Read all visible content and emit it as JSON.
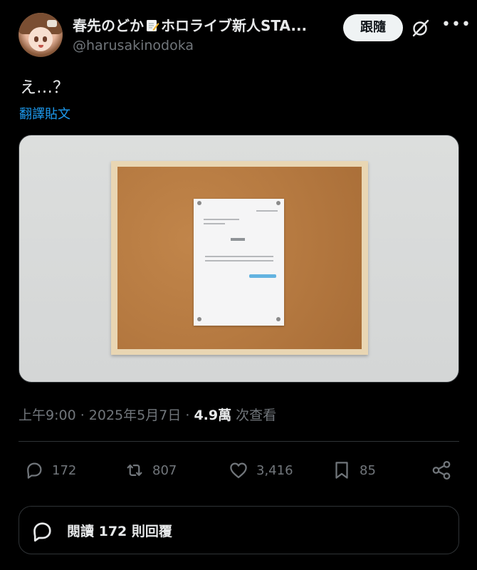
{
  "author": {
    "display_name_part1": "春先のどか",
    "display_name_part2": "ホロライブ新人STA...",
    "handle": "@harusakinodoka",
    "avatar_icon": "avatar"
  },
  "header": {
    "follow_label": "跟隨",
    "grok_icon": "grok-icon",
    "more_icon": "more-icon"
  },
  "tweet": {
    "text": "え…？",
    "translate_label": "翻譯貼文"
  },
  "meta": {
    "timestamp": "上午9:00 · 2025年5月7日 · ",
    "views_count": "4.9萬",
    "views_label": " 次查看"
  },
  "actions": {
    "replies": "172",
    "reposts": "807",
    "likes": "3,416",
    "bookmarks": "85"
  },
  "read_replies": {
    "label": "閱讀 172 則回覆"
  },
  "colors": {
    "background": "#000000",
    "link": "#1d9bf0",
    "muted": "#71767b",
    "text": "#e7e9ea"
  }
}
